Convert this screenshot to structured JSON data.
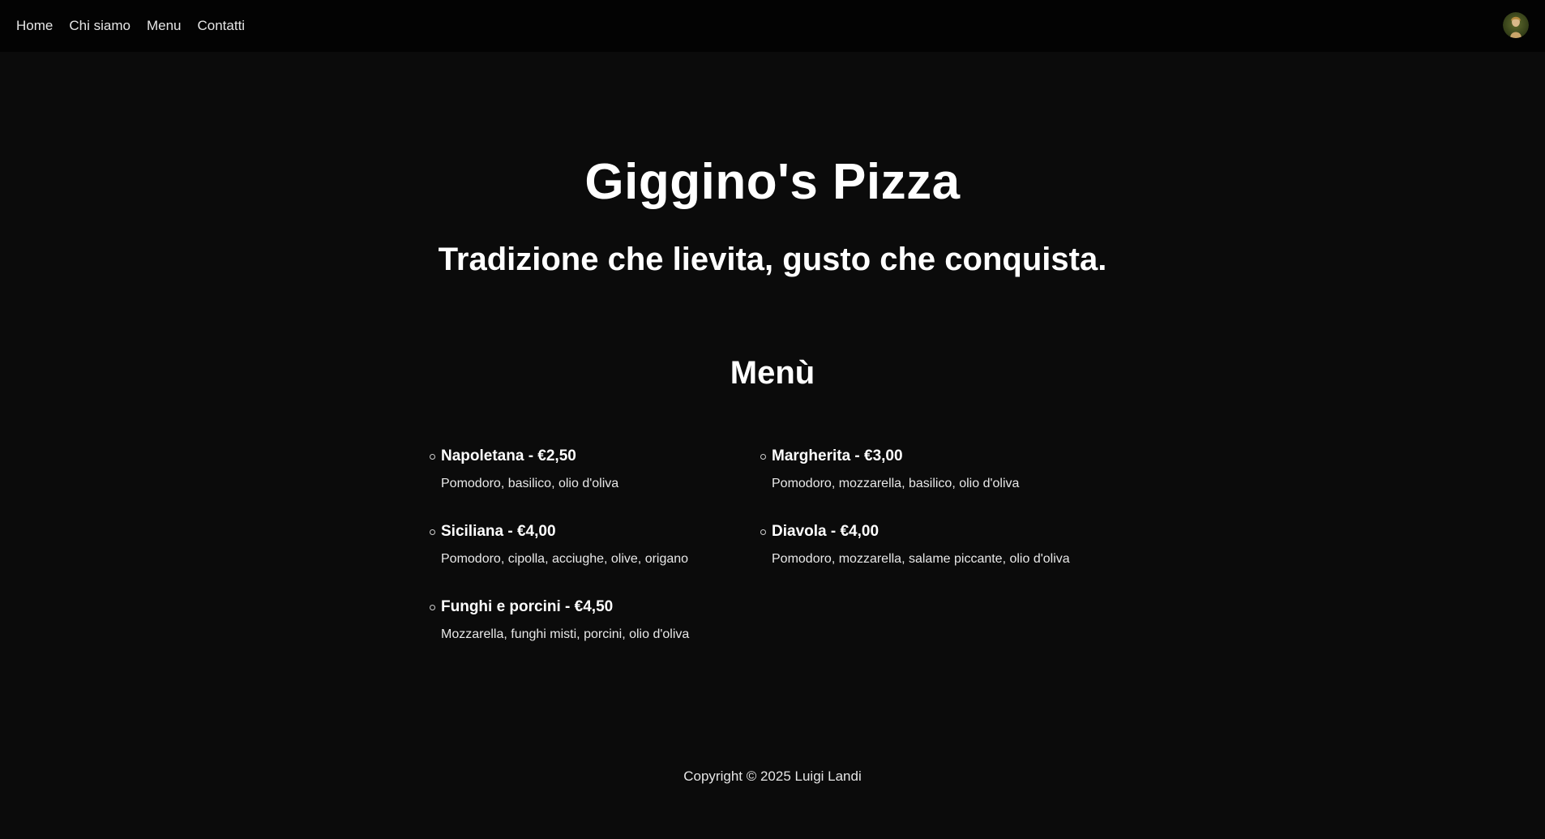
{
  "nav": {
    "links": [
      "Home",
      "Chi siamo",
      "Menu",
      "Contatti"
    ]
  },
  "hero": {
    "title": "Giggino's Pizza",
    "subtitle": "Tradizione che lievita, gusto che conquista."
  },
  "menu": {
    "title": "Menù",
    "left_items": [
      {
        "name": "Napoletana - €2,50",
        "desc": "Pomodoro, basilico, olio d'oliva"
      },
      {
        "name": "Siciliana - €4,00",
        "desc": "Pomodoro, cipolla, acciughe, olive, origano"
      },
      {
        "name": "Funghi e porcini - €4,50",
        "desc": "Mozzarella, funghi misti, porcini, olio d'oliva"
      }
    ],
    "right_items": [
      {
        "name": "Margherita - €3,00",
        "desc": "Pomodoro, mozzarella, basilico, olio d'oliva"
      },
      {
        "name": "Diavola - €4,00",
        "desc": "Pomodoro, mozzarella, salame piccante, olio d'oliva"
      }
    ]
  },
  "footer": {
    "text": "Copyright © 2025 Luigi Landi"
  },
  "colors": {
    "background": "#0b0b0b",
    "navbar": "#030303",
    "text": "#ffffff"
  },
  "icons": {
    "avatar": "avatar-icon",
    "bullet": "circle-bullet-icon"
  }
}
